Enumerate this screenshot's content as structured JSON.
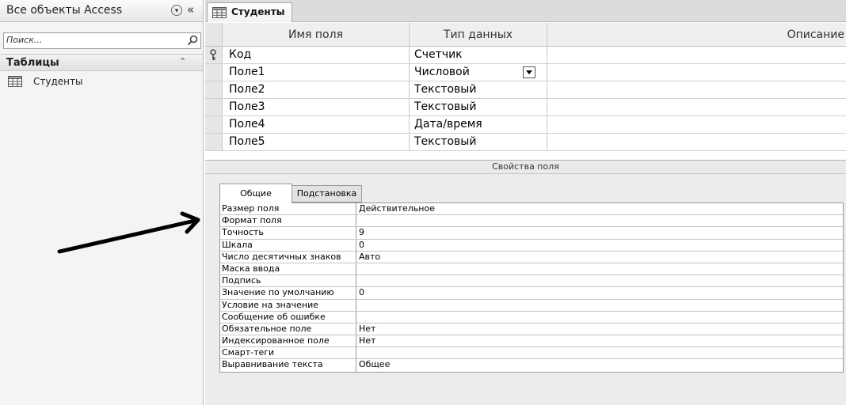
{
  "nav": {
    "title": "Все объекты Access",
    "search_placeholder": "Поиск...",
    "group_label": "Таблицы",
    "items": [
      {
        "label": "Студенты",
        "icon": "table-icon"
      }
    ]
  },
  "document": {
    "tab_label": "Студенты",
    "grid": {
      "headers": {
        "name": "Имя поля",
        "type": "Тип данных",
        "desc": "Описание"
      },
      "rows": [
        {
          "name": "Код",
          "type": "Счетчик",
          "key": true
        },
        {
          "name": "Поле1",
          "type": "Числовой",
          "dropdown": true
        },
        {
          "name": "Поле2",
          "type": "Текстовый"
        },
        {
          "name": "Поле3",
          "type": "Текстовый"
        },
        {
          "name": "Поле4",
          "type": "Дата/время"
        },
        {
          "name": "Поле5",
          "type": "Текстовый"
        }
      ]
    },
    "field_props": {
      "title": "Свойства поля",
      "tabs": {
        "general": "Общие",
        "lookup": "Подстановка"
      },
      "rows": [
        {
          "label": "Размер поля",
          "value": "Действительное"
        },
        {
          "label": "Формат поля",
          "value": ""
        },
        {
          "label": "Точность",
          "value": "9"
        },
        {
          "label": "Шкала",
          "value": "0"
        },
        {
          "label": "Число десятичных знаков",
          "value": "Авто"
        },
        {
          "label": "Маска ввода",
          "value": ""
        },
        {
          "label": "Подпись",
          "value": ""
        },
        {
          "label": "Значение по умолчанию",
          "value": "0"
        },
        {
          "label": "Условие на значение",
          "value": ""
        },
        {
          "label": "Сообщение об ошибке",
          "value": ""
        },
        {
          "label": "Обязательное поле",
          "value": "Нет"
        },
        {
          "label": "Индексированное поле",
          "value": "Нет"
        },
        {
          "label": "Смарт-теги",
          "value": ""
        },
        {
          "label": "Выравнивание текста",
          "value": "Общее"
        }
      ]
    }
  }
}
